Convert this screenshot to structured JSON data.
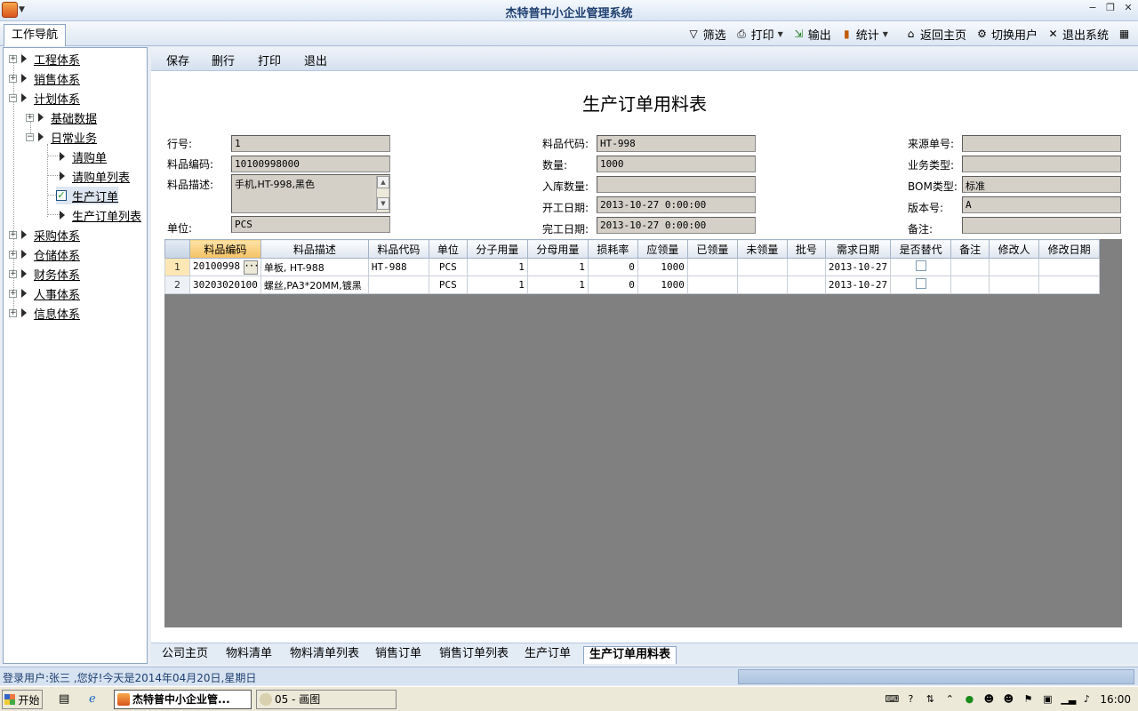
{
  "window": {
    "title": "杰特普中小企业管理系统"
  },
  "topbar": {
    "nav_tab": "工作导航",
    "toolbar": [
      {
        "label": "筛选",
        "icon": "filter-icon",
        "caret": false
      },
      {
        "label": "打印",
        "icon": "printer-icon",
        "caret": true
      },
      {
        "label": "输出",
        "icon": "export-icon",
        "caret": false
      },
      {
        "label": "统计",
        "icon": "bar-chart-icon",
        "caret": true
      },
      {
        "label": "返回主页",
        "icon": "home-icon",
        "caret": false
      },
      {
        "label": "切换用户",
        "icon": "switch-user-icon",
        "caret": false
      },
      {
        "label": "退出系统",
        "icon": "close-icon",
        "caret": false
      }
    ]
  },
  "sidebar": {
    "items": [
      {
        "label": "工程体系"
      },
      {
        "label": "销售体系"
      },
      {
        "label": "计划体系"
      },
      {
        "label": "基础数据"
      },
      {
        "label": "日常业务"
      },
      {
        "label": "请购单"
      },
      {
        "label": "请购单列表"
      },
      {
        "label": "生产订单"
      },
      {
        "label": "生产订单列表"
      },
      {
        "label": "采购体系"
      },
      {
        "label": "仓储体系"
      },
      {
        "label": "财务体系"
      },
      {
        "label": "人事体系"
      },
      {
        "label": "信息体系"
      }
    ]
  },
  "content": {
    "toolbar": {
      "save": "保存",
      "delete_row": "删行",
      "print": "打印",
      "exit": "退出"
    },
    "title": "生产订单用料表",
    "form": {
      "row_no": {
        "label": "行号:",
        "value": "1"
      },
      "item_code": {
        "label": "料品编码:",
        "value": "10100998000"
      },
      "item_desc": {
        "label": "料品描述:",
        "value": "手机,HT-998,黑色"
      },
      "unit": {
        "label": "单位:",
        "value": "PCS"
      },
      "item_id": {
        "label": "料品代码:",
        "value": "HT-998"
      },
      "quantity": {
        "label": "数量:",
        "value": "1000"
      },
      "stock_in_qty": {
        "label": "入库数量:",
        "value": ""
      },
      "start_date": {
        "label": "开工日期:",
        "value": "2013-10-27 0:00:00"
      },
      "finish_date": {
        "label": "完工日期:",
        "value": "2013-10-27 0:00:00"
      },
      "source_no": {
        "label": "来源单号:",
        "value": ""
      },
      "biz_type": {
        "label": "业务类型:",
        "value": ""
      },
      "bom_type": {
        "label": "BOM类型:",
        "value": "标准"
      },
      "version": {
        "label": "版本号:",
        "value": "A"
      },
      "remark": {
        "label": "备注:",
        "value": ""
      }
    },
    "grid": {
      "columns": [
        "料品编码",
        "料品描述",
        "料品代码",
        "单位",
        "分子用量",
        "分母用量",
        "损耗率",
        "应领量",
        "已领量",
        "未领量",
        "批号",
        "需求日期",
        "是否替代",
        "备注",
        "修改人",
        "修改日期"
      ],
      "rows": [
        {
          "no": "1",
          "code": "20100998",
          "desc": "单板, HT-988",
          "item_id": "HT-988",
          "unit": "PCS",
          "num": "1",
          "den": "1",
          "loss": "0",
          "req": "1000",
          "got": "",
          "left": "",
          "batch": "",
          "date": "2013-10-27",
          "sub": "",
          "remark": "",
          "editor": "",
          "edit_date": ""
        },
        {
          "no": "2",
          "code": "30203020100",
          "desc": "螺丝,PA3*20MM,镀黑",
          "item_id": "",
          "unit": "PCS",
          "num": "1",
          "den": "1",
          "loss": "0",
          "req": "1000",
          "got": "",
          "left": "",
          "batch": "",
          "date": "2013-10-27",
          "sub": "",
          "remark": "",
          "editor": "",
          "edit_date": ""
        }
      ]
    }
  },
  "bottom_tabs": [
    "公司主页",
    "物料清单",
    "物料清单列表",
    "销售订单",
    "销售订单列表",
    "生产订单",
    "生产订单用料表"
  ],
  "status": {
    "text": "登录用户:张三 ,您好!今天是2014年04月20日,星期日"
  },
  "taskbar": {
    "start": "开始",
    "tasks": [
      "杰特普中小企业管...",
      "05 - 画图"
    ],
    "clock": "16:00"
  }
}
